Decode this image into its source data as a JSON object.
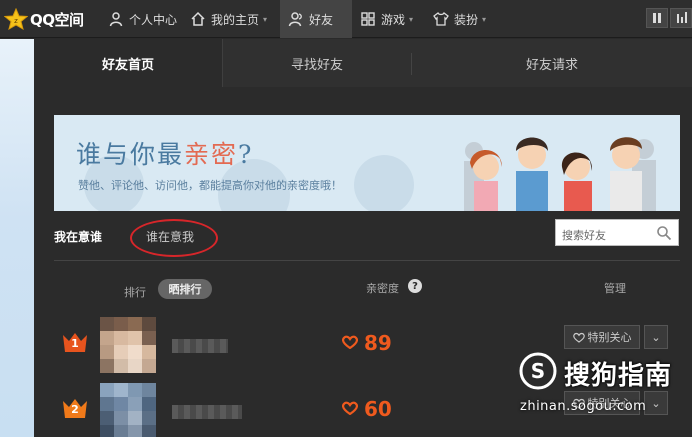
{
  "brand": {
    "logo_text": "QQ空间"
  },
  "topnav": [
    {
      "label": "个人中心",
      "icon": "person-icon"
    },
    {
      "label": "我的主页",
      "icon": "home-icon"
    },
    {
      "label": "好友",
      "icon": "friends-icon",
      "active": true
    },
    {
      "label": "游戏",
      "icon": "grid-icon"
    },
    {
      "label": "装扮",
      "icon": "shirt-icon"
    }
  ],
  "tabs": {
    "home": "好友首页",
    "find": "寻找好友",
    "requests": "好友请求"
  },
  "banner": {
    "title_pre": "谁与你最",
    "title_hl": "亲密",
    "title_post": "?",
    "subtitle": "赞他、评论他、访问他，都能提高你对他的亲密度哦！"
  },
  "subtabs": {
    "mine": "我在意谁",
    "theirs": "谁在意我"
  },
  "search": {
    "placeholder": "搜索好友"
  },
  "columns": {
    "rank": "排行",
    "rank_btn": "晒排行",
    "intimacy": "亲密度",
    "help": "?",
    "manage": "管理"
  },
  "rows": [
    {
      "rank": "1",
      "score": "89",
      "special_label": "特别关心",
      "drop": "⌄"
    },
    {
      "rank": "2",
      "score": "60",
      "special_label": "特别关心",
      "drop": "⌄"
    }
  ],
  "watermark": {
    "big": "搜狗指南",
    "small": "zhinan.sogou.com"
  },
  "colors": {
    "accent_orange": "#ef5a1e",
    "highlight_red": "#d7262a",
    "banner_bg": "#d8e8f2"
  }
}
